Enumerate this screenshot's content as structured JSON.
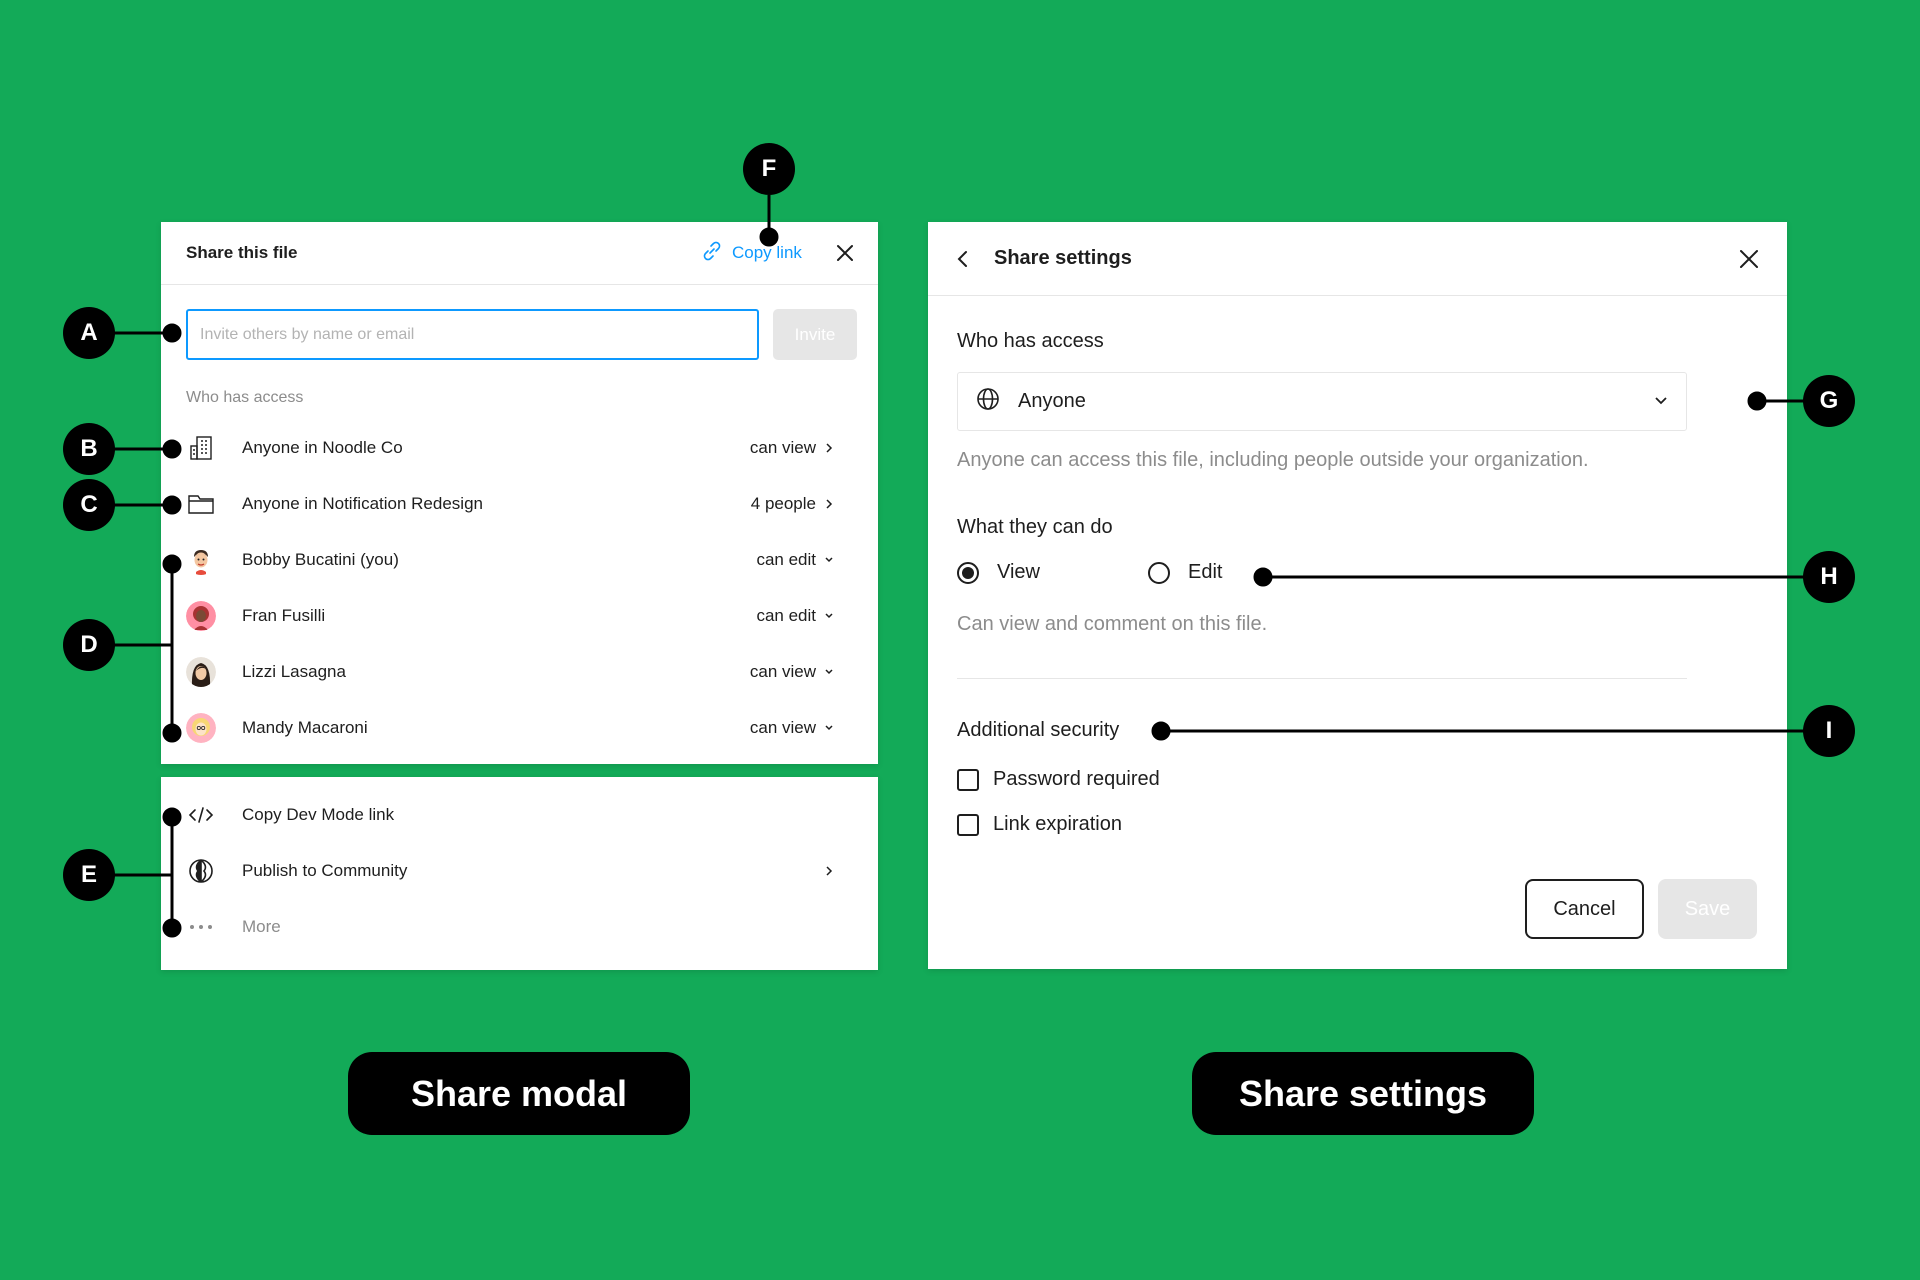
{
  "share_modal": {
    "title": "Share this file",
    "copy_link_label": "Copy link",
    "invite_placeholder": "Invite others by name or email",
    "invite_button": "Invite",
    "who_has_access_label": "Who has access",
    "access_rows": [
      {
        "label": "Anyone in Noodle Co",
        "permission": "can view",
        "icon": "building-icon",
        "chevron": "chevron-right-icon"
      },
      {
        "label": "Anyone in Notification Redesign",
        "permission": "4 people",
        "icon": "folder-icon",
        "chevron": "chevron-right-icon"
      },
      {
        "label": "Bobby Bucatini (you)",
        "permission": "can edit",
        "icon": "avatar",
        "chevron": "chevron-down-icon"
      },
      {
        "label": "Fran Fusilli",
        "permission": "can edit",
        "icon": "avatar",
        "chevron": "chevron-down-icon"
      },
      {
        "label": "Lizzi Lasagna",
        "permission": "can view",
        "icon": "avatar",
        "chevron": "chevron-down-icon"
      },
      {
        "label": "Mandy Macaroni",
        "permission": "can view",
        "icon": "avatar",
        "chevron": "chevron-down-icon"
      }
    ],
    "extra_actions": [
      {
        "label": "Copy Dev Mode link",
        "icon": "code-icon"
      },
      {
        "label": "Publish to Community",
        "icon": "community-globe-icon",
        "chevron": "chevron-right-icon"
      },
      {
        "label": "More",
        "icon": "more-dots-icon"
      }
    ]
  },
  "share_settings": {
    "title": "Share settings",
    "who_has_access_heading": "Who has access",
    "access_selected": "Anyone",
    "access_help": "Anyone can access this file, including people outside your organization.",
    "what_they_can_do_heading": "What they can do",
    "options": [
      {
        "label": "View",
        "selected": true
      },
      {
        "label": "Edit",
        "selected": false
      }
    ],
    "permission_help": "Can view and comment on this file.",
    "additional_security_heading": "Additional security",
    "checkboxes": [
      {
        "label": "Password required",
        "checked": false
      },
      {
        "label": "Link expiration",
        "checked": false
      }
    ],
    "cancel_button": "Cancel",
    "save_button": "Save"
  },
  "annotations": {
    "markers": [
      "A",
      "B",
      "C",
      "D",
      "E",
      "F",
      "G",
      "H",
      "I"
    ]
  },
  "captions": {
    "left": "Share modal",
    "right": "Share settings"
  },
  "colors": {
    "background": "#13AA58",
    "accent_blue": "#0d99ff",
    "marker": "#000000"
  }
}
